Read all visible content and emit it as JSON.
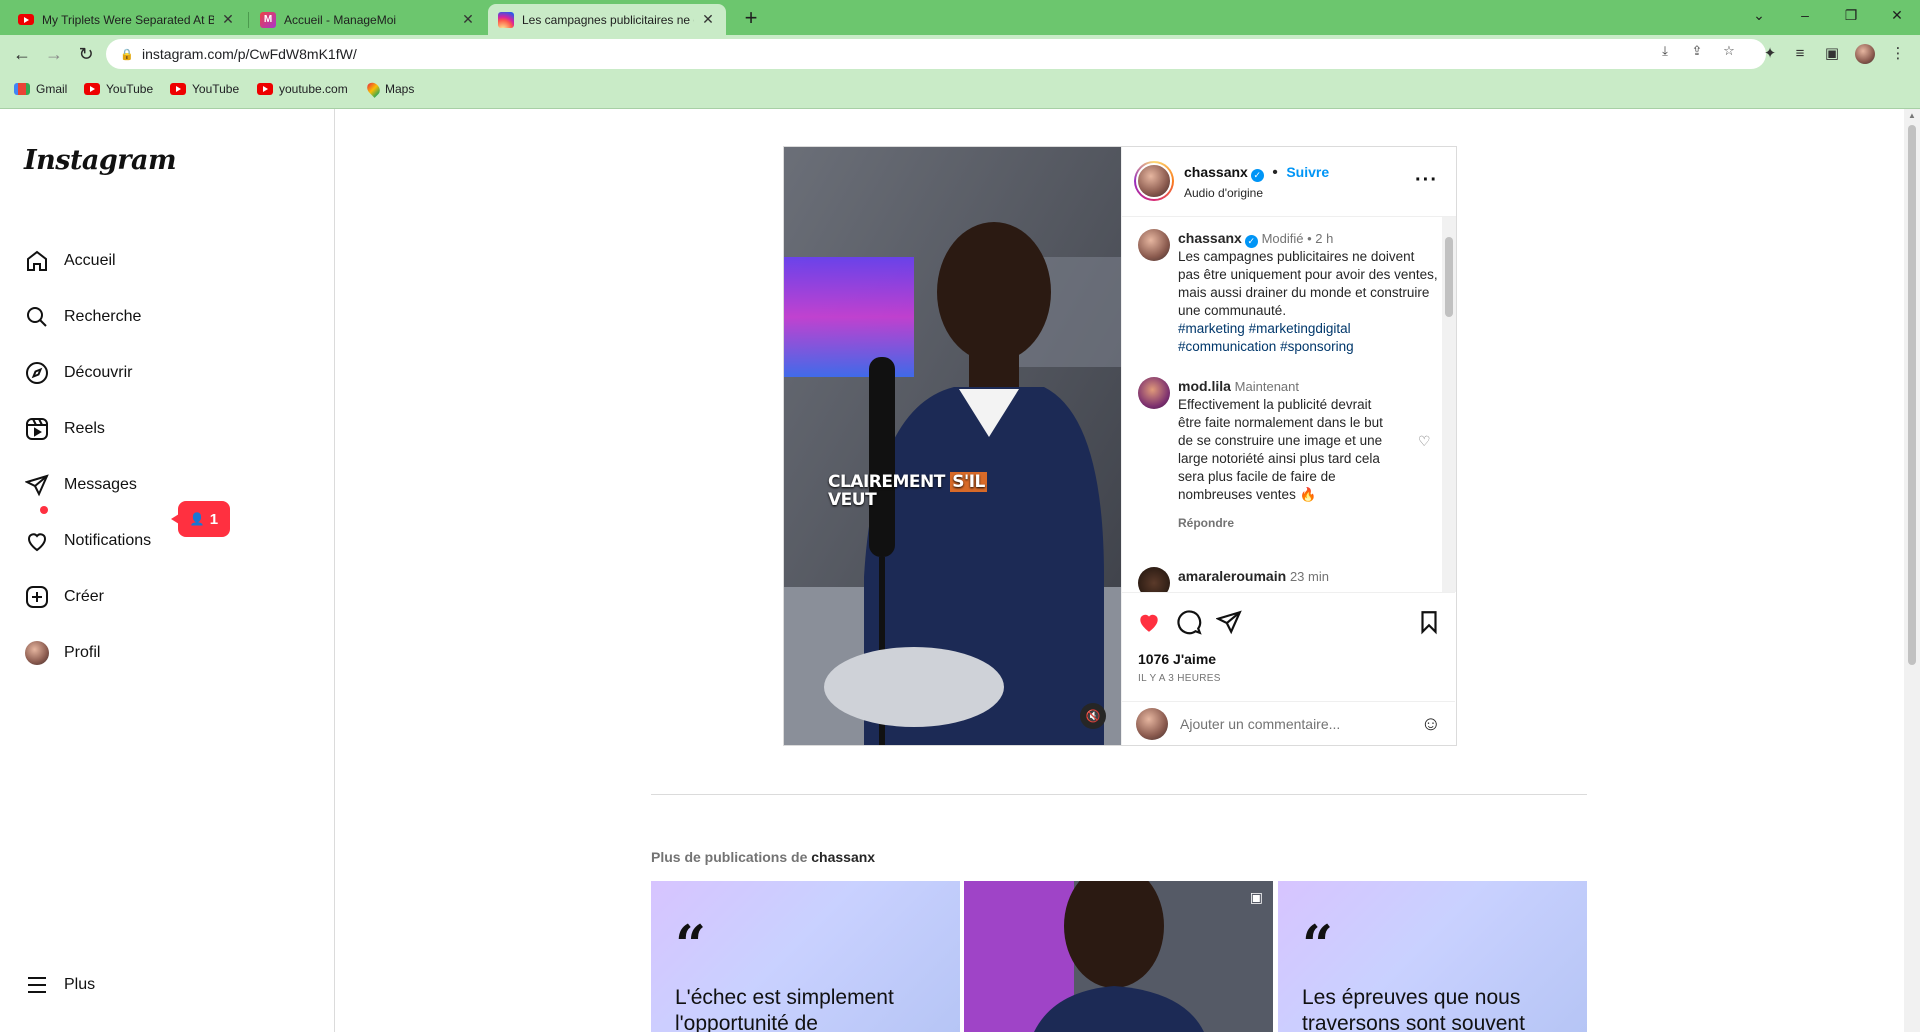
{
  "browser": {
    "tabs": [
      {
        "title": "My Triplets Were Separated At Birth",
        "icon": "youtube-icon"
      },
      {
        "title": "Accueil - ManageMoi",
        "icon": "managemoi-icon"
      },
      {
        "title": "Les campagnes publicitaires ne doivent",
        "icon": "instagram-icon",
        "active": true
      }
    ],
    "url": "instagram.com/p/CwFdW8mK1fW/",
    "bookmarks": [
      {
        "label": "Gmail",
        "icon": "gmail-icon"
      },
      {
        "label": "YouTube",
        "icon": "youtube-icon"
      },
      {
        "label": "YouTube",
        "icon": "youtube-icon"
      },
      {
        "label": "youtube.com",
        "icon": "youtube-icon"
      },
      {
        "label": "Maps",
        "icon": "maps-icon"
      }
    ]
  },
  "sidebar": {
    "logo": "Instagram",
    "items": [
      {
        "label": "Accueil",
        "icon": "home-icon"
      },
      {
        "label": "Recherche",
        "icon": "search-icon"
      },
      {
        "label": "Découvrir",
        "icon": "compass-icon"
      },
      {
        "label": "Reels",
        "icon": "reels-icon"
      },
      {
        "label": "Messages",
        "icon": "send-icon"
      },
      {
        "label": "Notifications",
        "icon": "heart-icon"
      },
      {
        "label": "Créer",
        "icon": "plus-square-icon"
      },
      {
        "label": "Profil",
        "icon": "avatar"
      }
    ],
    "notification_badge": "1",
    "more": "Plus"
  },
  "post": {
    "author": "chassanx",
    "follow": "Suivre",
    "audio": "Audio d'origine",
    "caption": {
      "author": "chassanx",
      "edited": "Modifié",
      "time": "2 h",
      "text": "Les campagnes publicitaires ne doivent pas être uniquement pour avoir des ventes, mais aussi drainer du monde et construire une communauté.",
      "tags": [
        "#marketing",
        "#marketingdigital",
        "#communication",
        "#sponsoring"
      ]
    },
    "comments": [
      {
        "author": "mod.lila",
        "time": "Maintenant",
        "text": "Effectivement la publicité devrait être faite normalement dans le but de se construire une image et une large notoriété ainsi plus tard cela sera plus facile de faire de nombreuses ventes 🔥",
        "reply": "Répondre"
      },
      {
        "author": "amaraleroumain",
        "time": "23 min"
      }
    ],
    "video_caption": {
      "line1_a": "CLAIREMENT",
      "line1_b": "S'IL",
      "line2": "VEUT"
    },
    "likes": "1076 J'aime",
    "posted": "IL Y A 3 HEURES",
    "comment_placeholder": "Ajouter un commentaire..."
  },
  "more_posts": {
    "prefix": "Plus de publications de",
    "author": "chassanx",
    "items": [
      {
        "type": "quote",
        "text": "L'échec est simplement l'opportunité de"
      },
      {
        "type": "reel"
      },
      {
        "type": "quote",
        "text": "Les épreuves que nous traversons sont souvent"
      }
    ]
  },
  "colors": {
    "accent": "#0095f6",
    "like": "#ff3040",
    "chrome_tabstrip": "#6cc66e",
    "chrome_toolbar": "#c9ebc7"
  }
}
